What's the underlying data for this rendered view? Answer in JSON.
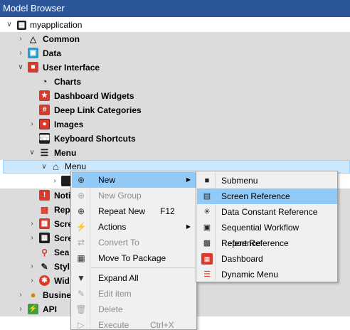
{
  "window": {
    "title": "Model Browser"
  },
  "tree": {
    "root": "myapplication",
    "common": "Common",
    "data": "Data",
    "user_interface": "User Interface",
    "charts": "Charts",
    "dashboard_widgets": "Dashboard Widgets",
    "deep_link_categories": "Deep Link Categories",
    "images": "Images",
    "keyboard_shortcuts": "Keyboard Shortcuts",
    "menu": "Menu",
    "menu_item": "Menu",
    "noti_partial": "Noti",
    "rep_partial": "Rep",
    "scre1_partial": "Scre",
    "scre2_partial": "Scre",
    "sea_partial": "Sea",
    "styl_partial": "Styl",
    "wid_partial": "Wid",
    "business_partial": "Busine",
    "api": "API"
  },
  "context_menu": {
    "new": "New",
    "new_group": "New Group",
    "repeat_new": "Repeat New",
    "repeat_new_shortcut": "F12",
    "actions": "Actions",
    "convert_to": "Convert To",
    "move_to_package": "Move To Package",
    "expand_all": "Expand All",
    "edit_item": "Edit item",
    "delete": "Delete",
    "execute": "Execute",
    "execute_shortcut": "Ctrl+X"
  },
  "submenu": {
    "submenu": "Submenu",
    "screen_reference": "Screen Reference",
    "data_constant_reference": "Data Constant Reference",
    "sequential_workflow_reference": "Sequential Workflow Reference",
    "report_reference": "Report Reference",
    "dashboard": "Dashboard",
    "dynamic_menu": "Dynamic Menu"
  },
  "colors": {
    "titlebar": "#2b579a",
    "band": "#dcdcdc",
    "selection": "#cce8ff",
    "menu_hover": "#91c9f7",
    "menu_bg": "#f0f0f0"
  }
}
